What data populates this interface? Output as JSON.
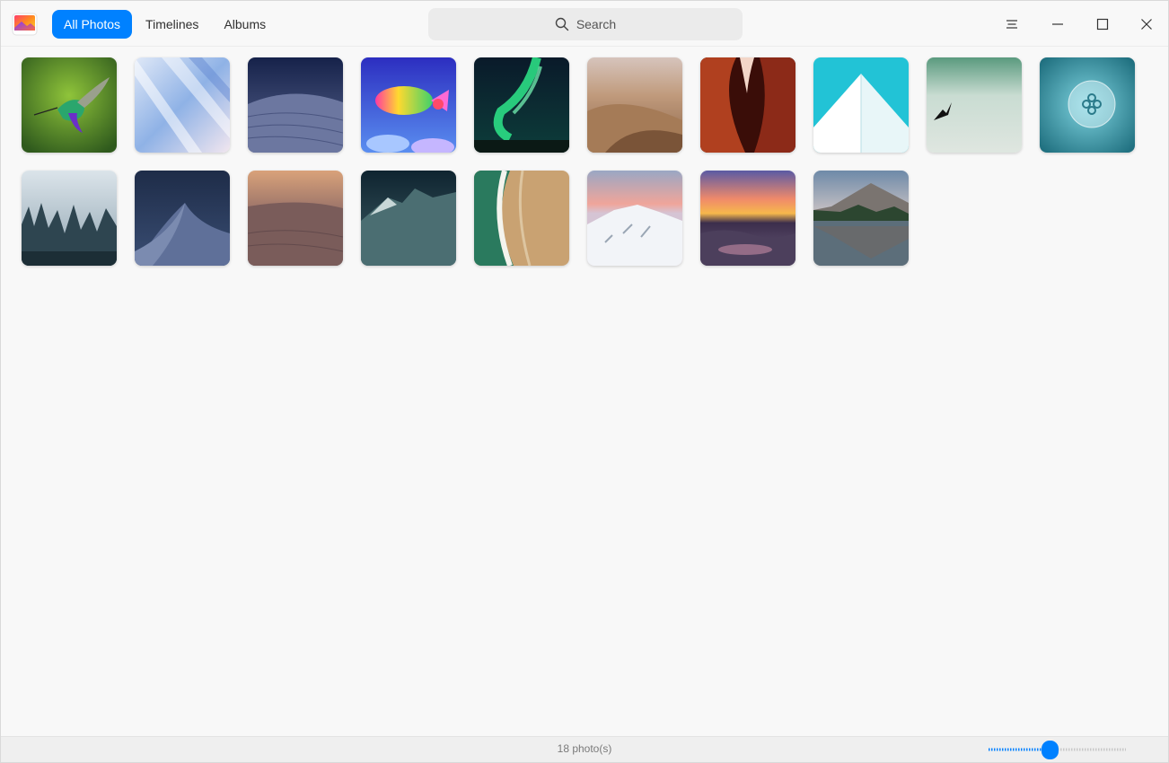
{
  "titlebar": {
    "tabs": [
      {
        "label": "All Photos",
        "active": true
      },
      {
        "label": "Timelines",
        "active": false
      },
      {
        "label": "Albums",
        "active": false
      }
    ],
    "search": {
      "placeholder": "Search",
      "icon": "search-icon"
    },
    "window_controls": [
      "menu-icon",
      "minimize-icon",
      "maximize-icon",
      "close-icon"
    ]
  },
  "photos": [
    {
      "name": "hummingbird"
    },
    {
      "name": "light-streaks"
    },
    {
      "name": "night-dunes"
    },
    {
      "name": "rainbow-fish"
    },
    {
      "name": "aurora"
    },
    {
      "name": "desert-dunes"
    },
    {
      "name": "red-canyon"
    },
    {
      "name": "white-building"
    },
    {
      "name": "bird-mist"
    },
    {
      "name": "jellyfish"
    },
    {
      "name": "misty-forest"
    },
    {
      "name": "blue-dune"
    },
    {
      "name": "sunset-dune"
    },
    {
      "name": "cloud-mountain"
    },
    {
      "name": "aerial-beach"
    },
    {
      "name": "snow-mountain"
    },
    {
      "name": "sunset-shore"
    },
    {
      "name": "mountain-lake"
    }
  ],
  "status": {
    "count_text": "18 photo(s)",
    "zoom_level": 0.45
  },
  "colors": {
    "accent": "#0081ff"
  }
}
